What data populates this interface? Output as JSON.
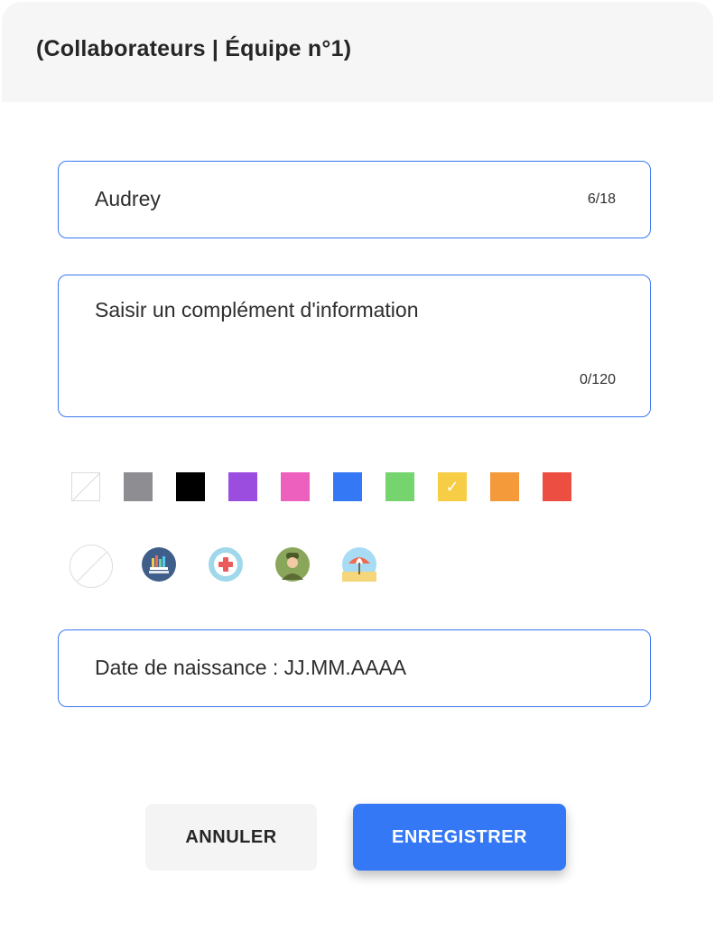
{
  "dialog": {
    "title": "(Collaborateurs | Équipe n°1)"
  },
  "name_field": {
    "value": "Audrey",
    "counter": "6/18"
  },
  "info_field": {
    "placeholder": "Saisir un complément d'information",
    "counter": "0/120"
  },
  "colors": [
    {
      "name": "none",
      "hex": "#ffffff"
    },
    {
      "name": "gray",
      "hex": "#8e8e92"
    },
    {
      "name": "black",
      "hex": "#000000"
    },
    {
      "name": "purple",
      "hex": "#9b4ddf"
    },
    {
      "name": "pink",
      "hex": "#ee60bd"
    },
    {
      "name": "blue",
      "hex": "#3478f6"
    },
    {
      "name": "green",
      "hex": "#76d46f"
    },
    {
      "name": "yellow",
      "hex": "#f7cd45",
      "selected": true
    },
    {
      "name": "orange",
      "hex": "#f49a3a"
    },
    {
      "name": "red",
      "hex": "#ec4f42"
    }
  ],
  "avatars": [
    "none-icon",
    "books-chart-icon",
    "medical-cross-icon",
    "soldier-icon",
    "beach-umbrella-icon"
  ],
  "date_field": {
    "placeholder": "Date de naissance : JJ.MM.AAAA"
  },
  "buttons": {
    "cancel": "ANNULER",
    "save": "ENREGISTRER"
  }
}
